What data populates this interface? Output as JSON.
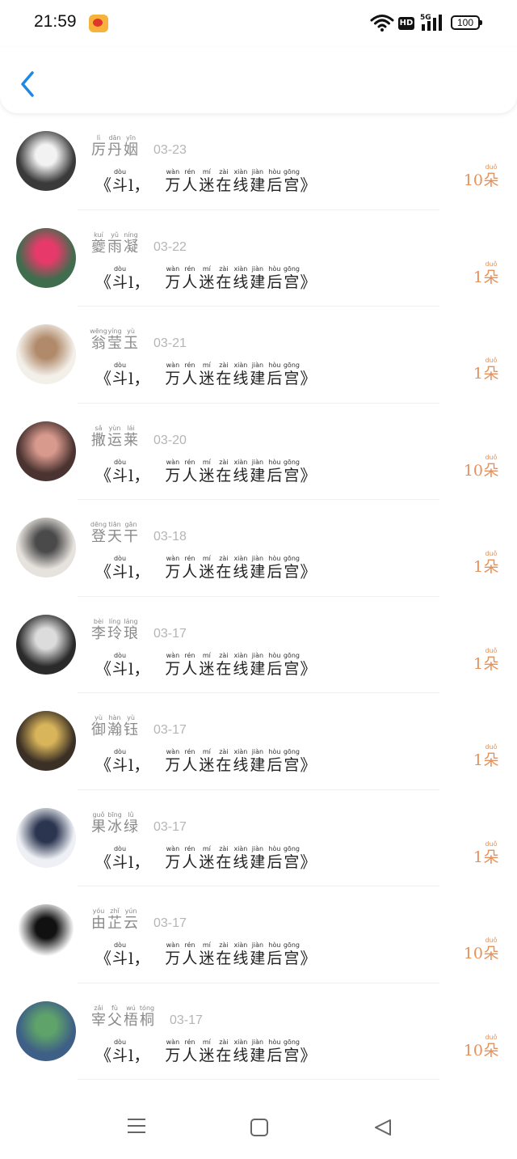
{
  "status": {
    "time": "21:59",
    "network": "5G",
    "hd": "HD",
    "battery": "100"
  },
  "colors": {
    "accent": "#1e88e5",
    "count": "#e6915a",
    "muted": "#8a8a8a"
  },
  "title_segments": [
    {
      "hz": "《",
      "py": ""
    },
    {
      "hz": "斗",
      "py": "dòu"
    },
    {
      "hz": "l，",
      "py": ""
    },
    {
      "hz": "万",
      "py": "wàn"
    },
    {
      "hz": "人",
      "py": "rén"
    },
    {
      "hz": "迷",
      "py": "mí"
    },
    {
      "hz": "在",
      "py": "zài"
    },
    {
      "hz": "线",
      "py": "xiàn"
    },
    {
      "hz": "建",
      "py": "jiàn"
    },
    {
      "hz": "后",
      "py": "hòu"
    },
    {
      "hz": "宫",
      "py": "gōng"
    },
    {
      "hz": "》",
      "py": ""
    }
  ],
  "count_unit": {
    "hz": "朵",
    "py": "duǒ"
  },
  "rows": [
    {
      "name": [
        {
          "hz": "厉",
          "py": "lì"
        },
        {
          "hz": "丹",
          "py": "dān"
        },
        {
          "hz": "姻",
          "py": "yīn"
        }
      ],
      "date": "03-23",
      "count": "10",
      "avatar_color": "#3a3a3a",
      "avatar_accent": "#f2f2f2"
    },
    {
      "name": [
        {
          "hz": "夔",
          "py": "kuí"
        },
        {
          "hz": "雨",
          "py": "yǔ"
        },
        {
          "hz": "凝",
          "py": "níng"
        }
      ],
      "date": "03-22",
      "count": "1",
      "avatar_color": "#3f6d4e",
      "avatar_accent": "#e83a6a"
    },
    {
      "name": [
        {
          "hz": "翁",
          "py": "wēng"
        },
        {
          "hz": "莹",
          "py": "yíng"
        },
        {
          "hz": "玉",
          "py": "yù"
        }
      ],
      "date": "03-21",
      "count": "1",
      "avatar_color": "#f3efe9",
      "avatar_accent": "#b08a6a"
    },
    {
      "name": [
        {
          "hz": "撒",
          "py": "sǎ"
        },
        {
          "hz": "运",
          "py": "yùn"
        },
        {
          "hz": "莱",
          "py": "lái"
        }
      ],
      "date": "03-20",
      "count": "10",
      "avatar_color": "#4a3330",
      "avatar_accent": "#d99a8e"
    },
    {
      "name": [
        {
          "hz": "登",
          "py": "dēng"
        },
        {
          "hz": "天",
          "py": "tiān"
        },
        {
          "hz": "干",
          "py": "gān"
        }
      ],
      "date": "03-18",
      "count": "1",
      "avatar_color": "#e6e2dd",
      "avatar_accent": "#4a4a4a"
    },
    {
      "name": [
        {
          "hz": "李",
          "py": "bèi"
        },
        {
          "hz": "玲",
          "py": "líng"
        },
        {
          "hz": "琅",
          "py": "láng"
        }
      ],
      "date": "03-17",
      "count": "1",
      "avatar_color": "#2a2a2a",
      "avatar_accent": "#dcdcdc"
    },
    {
      "name": [
        {
          "hz": "御",
          "py": "yù"
        },
        {
          "hz": "瀚",
          "py": "hàn"
        },
        {
          "hz": "钰",
          "py": "yù"
        }
      ],
      "date": "03-17",
      "count": "1",
      "avatar_color": "#3b3025",
      "avatar_accent": "#d8b45a"
    },
    {
      "name": [
        {
          "hz": "果",
          "py": "guǒ"
        },
        {
          "hz": "冰",
          "py": "bīng"
        },
        {
          "hz": "绿",
          "py": "lǜ"
        }
      ],
      "date": "03-17",
      "count": "1",
      "avatar_color": "#eef0f5",
      "avatar_accent": "#2b3550"
    },
    {
      "name": [
        {
          "hz": "由",
          "py": "yóu"
        },
        {
          "hz": "芷",
          "py": "zhǐ"
        },
        {
          "hz": "云",
          "py": "yún"
        }
      ],
      "date": "03-17",
      "count": "10",
      "avatar_color": "#ffffff",
      "avatar_accent": "#111111"
    },
    {
      "name": [
        {
          "hz": "宰",
          "py": "zǎi"
        },
        {
          "hz": "父",
          "py": "fù"
        },
        {
          "hz": "梧",
          "py": "wú"
        },
        {
          "hz": "桐",
          "py": "tóng"
        }
      ],
      "date": "03-17",
      "count": "10",
      "avatar_color": "#3e5f86",
      "avatar_accent": "#5fa36a"
    }
  ]
}
